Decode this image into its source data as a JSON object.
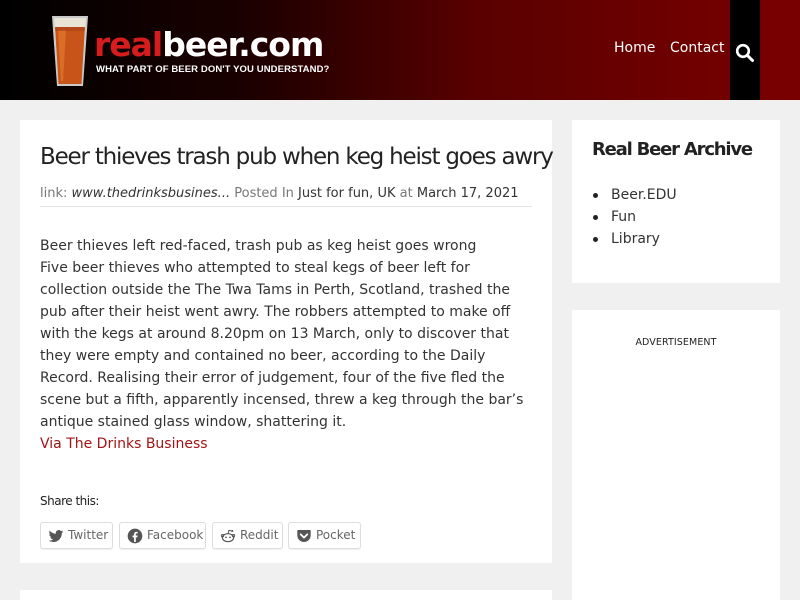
{
  "header": {
    "logo": {
      "part1": "real",
      "part2": "beer.com",
      "tagline": "WHAT PART OF BEER DON'T YOU UNDERSTAND?"
    },
    "nav": [
      {
        "label": "Home"
      },
      {
        "label": "Contact"
      }
    ],
    "search_icon": "search-icon",
    "colors": {
      "brand_red": "#d61c1c",
      "header_dark": "#000000",
      "header_red": "#7a0000"
    }
  },
  "article": {
    "title": "Beer thieves trash pub when keg heist goes awry",
    "meta": {
      "link_prefix": "link:",
      "link_text": "www.thedrinksbusines...",
      "posted_in_label": "Posted In",
      "category1": "Just for fun",
      "separator": ",",
      "category2": "UK",
      "at_label": "at",
      "date": "March 17, 2021"
    },
    "subheading": "Beer thieves left red-faced, trash pub as keg heist goes wrong",
    "body": "Five beer thieves who attempted to steal kegs of beer left for collection outside the The Twa Tams in Perth, Scotland, trashed the pub after their heist went awry. The robbers attempted to make off with the kegs at around 8.20pm on 13 March, only to discover that they were empty and contained no beer, according to the Daily Record. Realising their error of judgement, four of the five fled the scene but a fifth, apparently incensed, threw a keg through the bar’s antique stained glass window, shattering it.",
    "via_link": "Via The Drinks Business",
    "share": {
      "title": "Share this:",
      "buttons": [
        {
          "label": "Twitter",
          "icon": "twitter-icon"
        },
        {
          "label": "Facebook",
          "icon": "facebook-icon"
        },
        {
          "label": "Reddit",
          "icon": "reddit-icon"
        },
        {
          "label": "Pocket",
          "icon": "pocket-icon"
        }
      ]
    },
    "link_color": "#a01515"
  },
  "sidebar": {
    "archive_title": "Real Beer Archive",
    "archive_items": [
      {
        "label": "Beer.EDU"
      },
      {
        "label": "Fun"
      },
      {
        "label": "Library"
      }
    ],
    "ad_label": "ADVERTISEMENT"
  }
}
